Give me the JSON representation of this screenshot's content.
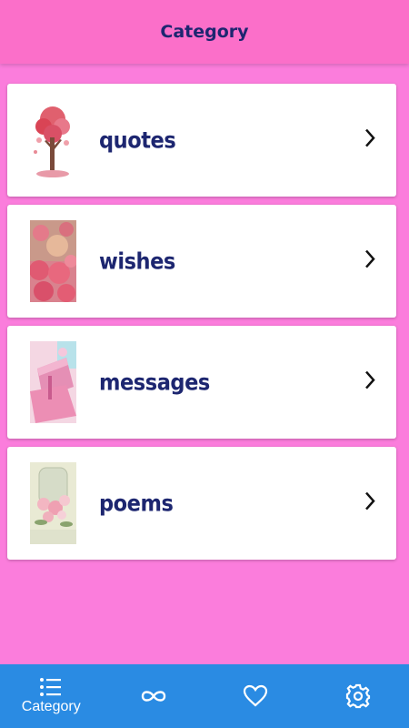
{
  "header": {
    "title": "Category"
  },
  "categories": [
    {
      "label": "quotes",
      "icon": "tree-hearts-image"
    },
    {
      "label": "wishes",
      "icon": "roses-bouquet-image"
    },
    {
      "label": "messages",
      "icon": "gift-box-image"
    },
    {
      "label": "poems",
      "icon": "flowers-vase-image"
    }
  ],
  "bottom_nav": {
    "items": [
      {
        "label": "Category",
        "icon": "list-icon"
      },
      {
        "label": "",
        "icon": "infinity-icon"
      },
      {
        "label": "",
        "icon": "heart-icon"
      },
      {
        "label": "",
        "icon": "gear-icon"
      }
    ]
  },
  "colors": {
    "background": "#fb7ddc",
    "appbar": "#fb6fc9",
    "title_text": "#1d2670",
    "bottom_nav": "#2a8be3"
  }
}
